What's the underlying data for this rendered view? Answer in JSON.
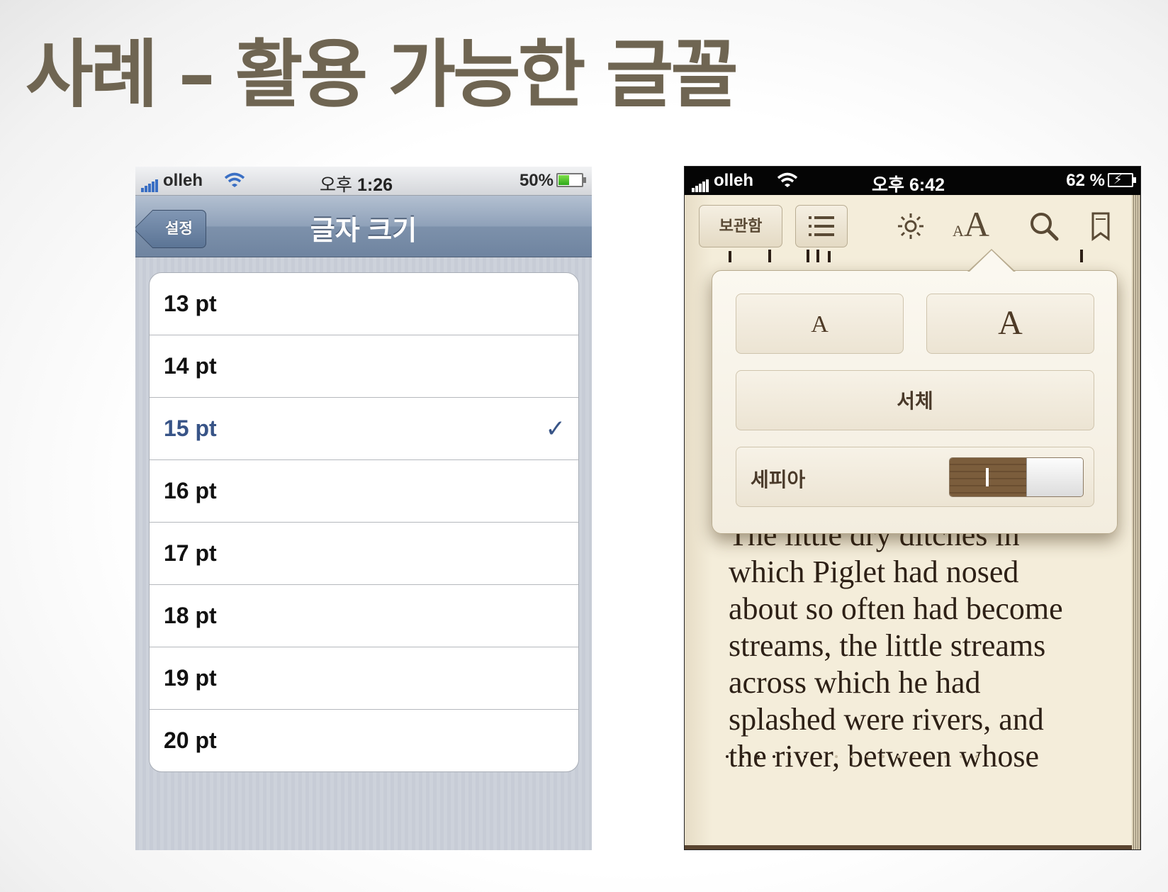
{
  "slide": {
    "title": "사례 – 활용 가능한 글꼴"
  },
  "left_phone": {
    "status_bar": {
      "carrier": "olleh",
      "time_prefix": "오후",
      "time": "1:26",
      "battery": "50%"
    },
    "battery_level_pct": 50,
    "nav": {
      "back_label": "설정",
      "title": "글자 크기"
    },
    "options": [
      {
        "label": "13 pt",
        "selected": false
      },
      {
        "label": "14 pt",
        "selected": false
      },
      {
        "label": "15 pt",
        "selected": true
      },
      {
        "label": "16 pt",
        "selected": false
      },
      {
        "label": "17 pt",
        "selected": false
      },
      {
        "label": "18 pt",
        "selected": false
      },
      {
        "label": "19 pt",
        "selected": false
      },
      {
        "label": "20 pt",
        "selected": false
      }
    ],
    "check_mark": "✓",
    "colors": {
      "selected_text": "#385487",
      "nav_bar": "#7d91ab"
    }
  },
  "right_phone": {
    "status_bar": {
      "carrier": "olleh",
      "time": "오후 6:42",
      "battery": "62 %"
    },
    "toolbar": {
      "library_label": "보관함",
      "toc_icon": "list-icon",
      "brightness_icon": "sun-icon",
      "font_size_icon": "font-size-icon",
      "font_size_small": "A",
      "font_size_large": "A",
      "search_icon": "search-icon",
      "bookmark_icon": "bookmark-icon"
    },
    "popover": {
      "smaller_font": "A",
      "larger_font": "A",
      "fonts_label": "서체",
      "sepia_label": "세피아",
      "sepia_on": true,
      "switch_on_glyph": "I"
    },
    "page_text": [
      "The little dry ditches in",
      "which Piglet had nosed",
      "about so often had become",
      "streams, the little streams",
      "across which he had",
      "splashed were rivers, and",
      "the river, between whose"
    ],
    "colors": {
      "paper": "#f4edda",
      "text": "#2d2016",
      "switch_on": "#7b5d3c"
    }
  }
}
